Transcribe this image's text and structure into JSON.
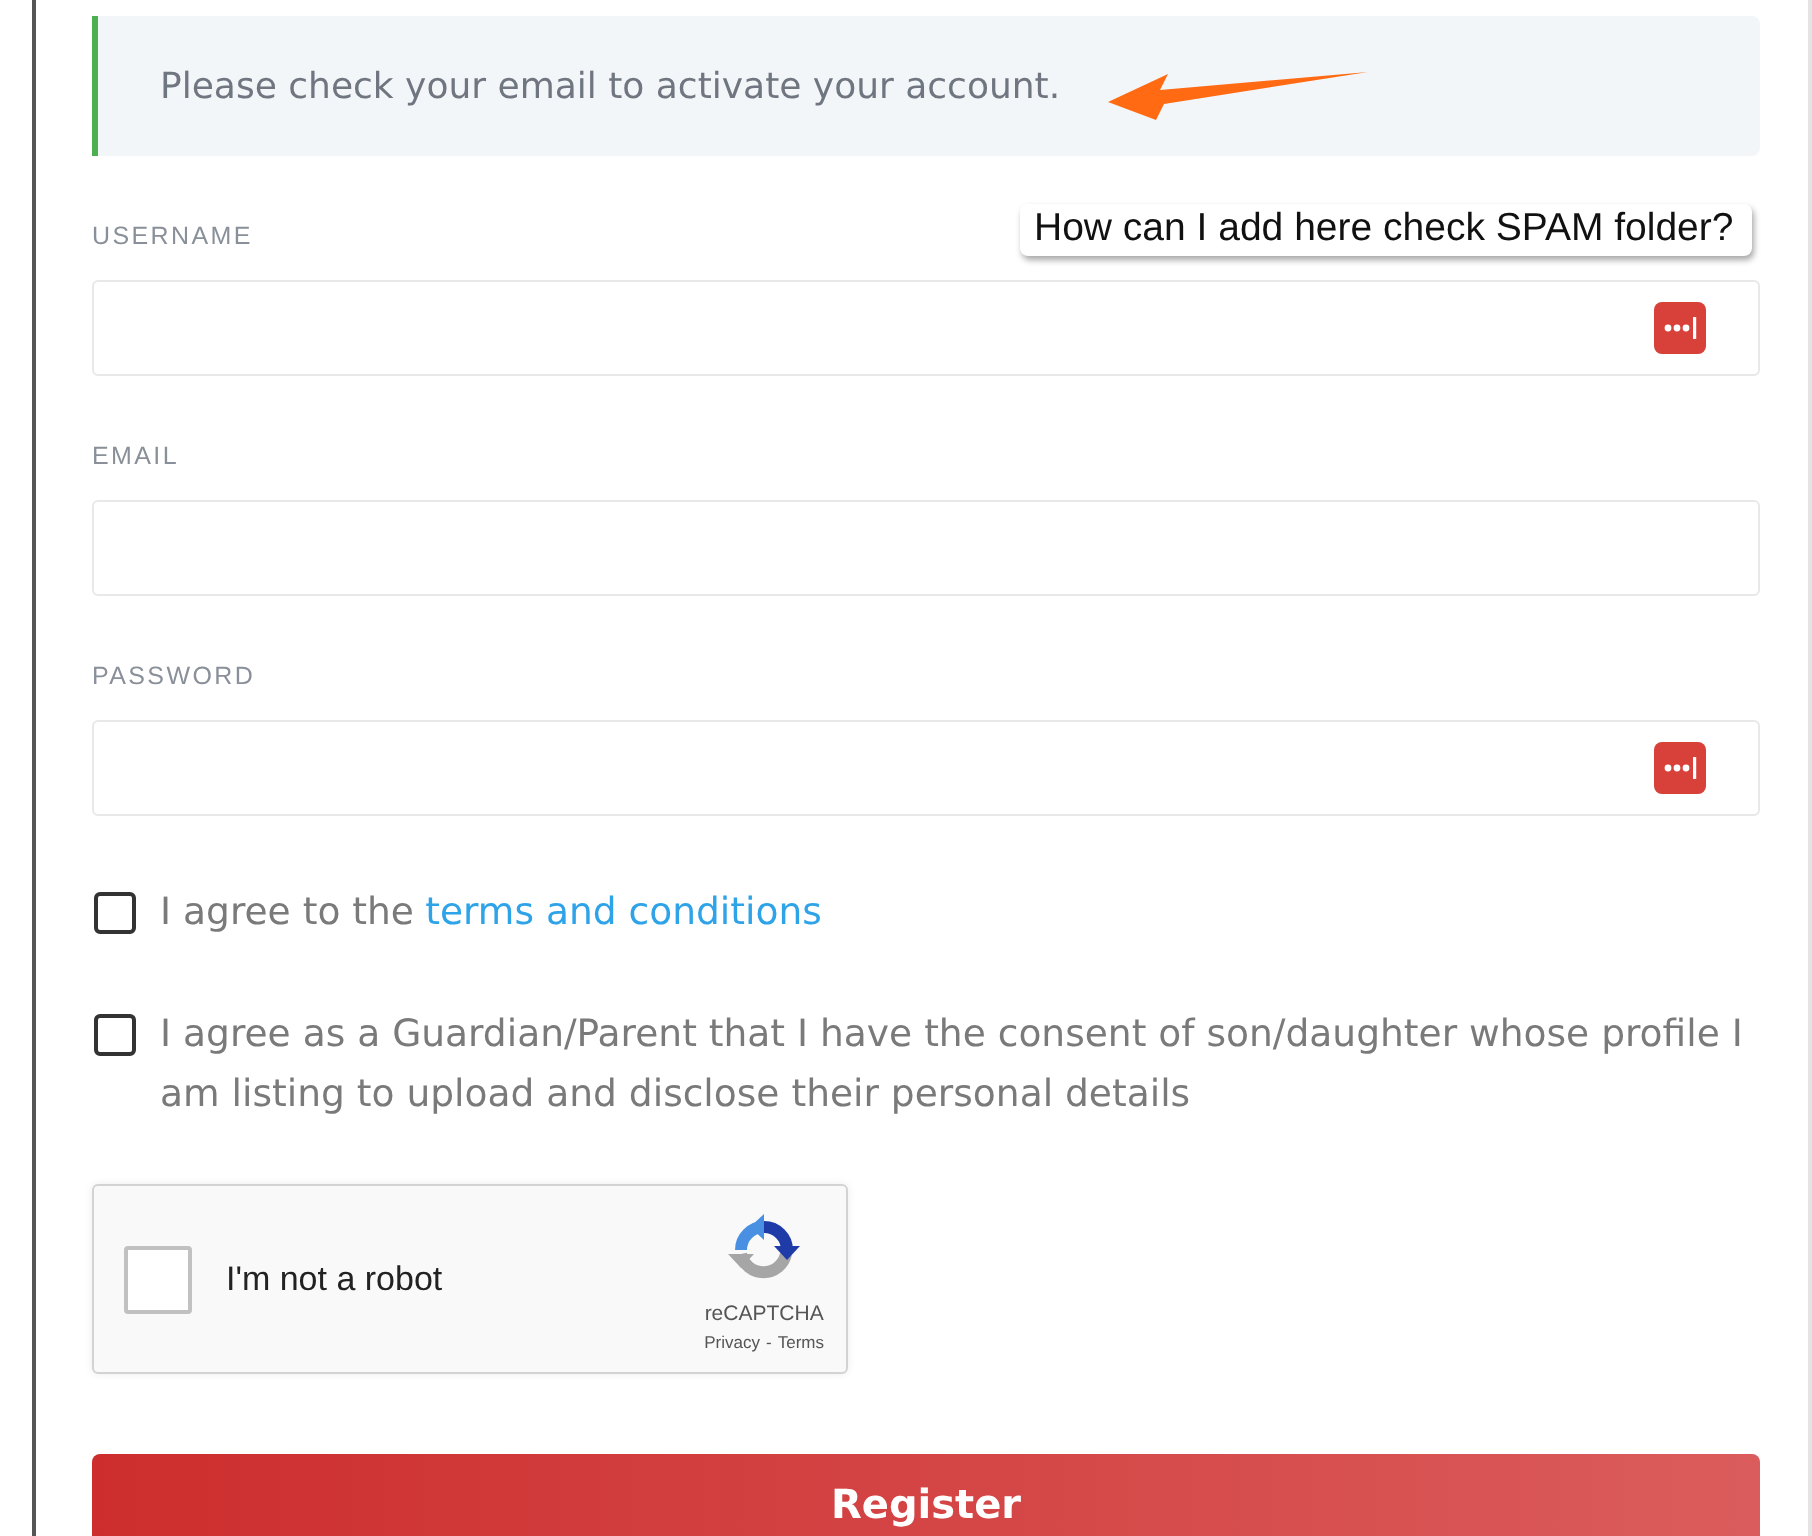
{
  "notice": {
    "message": "Please check your email to activate your account."
  },
  "annotation": {
    "callout": "How can I add here check SPAM folder?"
  },
  "fields": [
    {
      "label": "USERNAME",
      "manager_icon": true
    },
    {
      "label": "EMAIL",
      "manager_icon": false
    },
    {
      "label": "PASSWORD",
      "manager_icon": true
    }
  ],
  "agreements": [
    {
      "text": "I agree to the",
      "link": "terms and conditions",
      "checked": false
    },
    {
      "text": "I agree as a Guardian/Parent that I have the consent of son/daughter whose profile I am listing to upload and disclose their personal details",
      "checked": false
    }
  ],
  "captcha": {
    "label": "I'm not a robot",
    "checked": false,
    "brand": "reCAPTCHA",
    "links": [
      "Privacy",
      "Terms"
    ],
    "separator": "-"
  },
  "submit": {
    "label": "Register"
  }
}
